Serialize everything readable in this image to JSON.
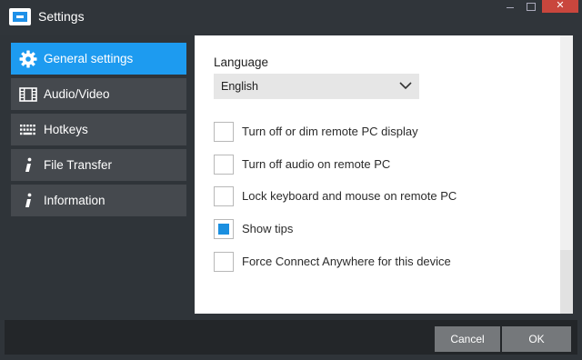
{
  "window": {
    "title": "Settings",
    "close_glyph": "✕"
  },
  "sidebar": {
    "items": [
      {
        "label": "General settings",
        "icon": "gear-icon",
        "active": true
      },
      {
        "label": "Audio/Video",
        "icon": "film-icon",
        "active": false
      },
      {
        "label": "Hotkeys",
        "icon": "keyboard-icon",
        "active": false
      },
      {
        "label": "File Transfer",
        "icon": "info-icon",
        "active": false
      },
      {
        "label": "Information",
        "icon": "info-icon",
        "active": false
      }
    ]
  },
  "main": {
    "language": {
      "label": "Language",
      "value": "English"
    },
    "options": [
      {
        "label": "Turn off or dim remote PC display",
        "checked": false
      },
      {
        "label": "Turn off audio on remote PC",
        "checked": false
      },
      {
        "label": "Lock keyboard and mouse on remote PC",
        "checked": false
      },
      {
        "label": "Show tips",
        "checked": true
      },
      {
        "label": "Force Connect Anywhere for this device",
        "checked": false
      }
    ]
  },
  "footer": {
    "cancel_label": "Cancel",
    "ok_label": "OK"
  },
  "colors": {
    "accent": "#1d9bf0",
    "sidebar_bg": "#45494e",
    "window_bg": "#2f3439",
    "close": "#c9463d"
  }
}
